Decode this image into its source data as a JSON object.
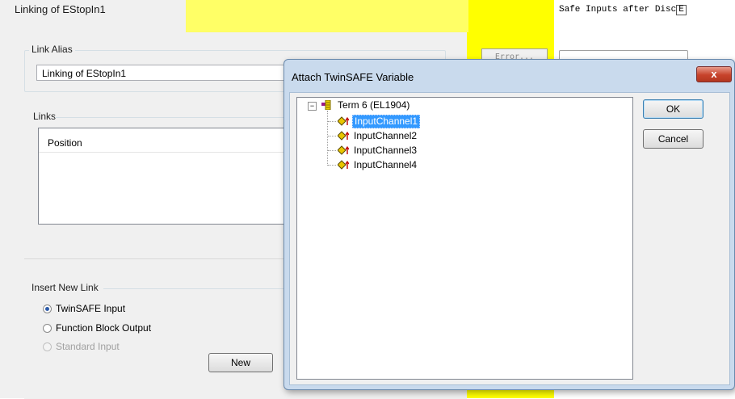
{
  "link_dialog": {
    "title": "Linking of EStopIn1",
    "alias_group_label": "Link Alias",
    "alias_value": "Linking of EStopIn1",
    "links_group_label": "Links",
    "links_table": {
      "columns": [
        "Position"
      ]
    },
    "insert_group_label": "Insert New Link",
    "radio_options": [
      {
        "label": "TwinSAFE Input",
        "selected": true,
        "enabled": true
      },
      {
        "label": "Function Block Output",
        "selected": false,
        "enabled": true
      },
      {
        "label": "Standard Input",
        "selected": false,
        "enabled": false
      }
    ],
    "new_button": "New"
  },
  "right_panel": {
    "error_button": "Error...",
    "safe_inputs_text": "Safe Inputs after Disc",
    "safe_inputs_suffix": "E"
  },
  "attach_dialog": {
    "title": "Attach TwinSAFE Variable",
    "close_glyph": "x",
    "tree": {
      "root": {
        "label": "Term 6 (EL1904)",
        "collapse_glyph": "−"
      },
      "children": [
        {
          "label": "InputChannel1",
          "selected": true
        },
        {
          "label": "InputChannel2",
          "selected": false
        },
        {
          "label": "InputChannel3",
          "selected": false
        },
        {
          "label": "InputChannel4",
          "selected": false
        }
      ]
    },
    "ok_button": "OK",
    "cancel_button": "Cancel"
  },
  "colors": {
    "yellow_band": "#ffff00",
    "selection": "#3399ff",
    "close_button": "#c7432b"
  },
  "icons": [
    "collapse-box-icon",
    "terminal-icon",
    "input-channel-icon",
    "close-icon",
    "radio-icon"
  ]
}
